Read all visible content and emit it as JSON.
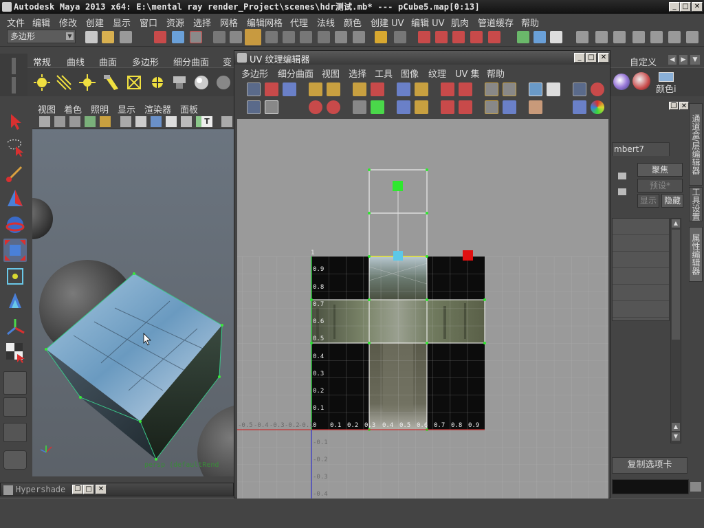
{
  "window": {
    "title": "Autodesk Maya 2013 x64: E:\\mental ray render_Project\\scenes\\hdr测试.mb*   ---   pCube5.map[0:13]",
    "min_label": "_",
    "max_label": "□",
    "close_label": "✕"
  },
  "main_menu": [
    "文件",
    "编辑",
    "修改",
    "创建",
    "显示",
    "窗口",
    "资源",
    "选择",
    "网格",
    "编辑网格",
    "代理",
    "法线",
    "颜色",
    "创建 UV",
    "编辑 UV",
    "肌肉",
    "管道缓存",
    "帮助"
  ],
  "status_line": {
    "mode": "多边形"
  },
  "shelf": {
    "tabs": [
      "常规",
      "曲线",
      "曲面",
      "多边形",
      "细分曲面",
      "变"
    ],
    "right_tabs": [
      "自定义"
    ],
    "right_label": "颜色i"
  },
  "viewport": {
    "menu": [
      "视图",
      "着色",
      "照明",
      "显示",
      "渲染器",
      "面板"
    ],
    "camera_label": "persp (defaultRend"
  },
  "hypershade": {
    "title": "Hypershade"
  },
  "uv_editor": {
    "title": "UV 纹理编辑器",
    "menu": [
      "多边形",
      "细分曲面",
      "视图",
      "选择",
      "工具",
      "图像",
      "纹理",
      "UV 集",
      "帮助"
    ],
    "v_ticks": [
      "1",
      "0.9",
      "0.8",
      "0.7",
      "0.6",
      "0.5",
      "0.4",
      "0.3",
      "0.2",
      "0.1"
    ],
    "u_ticks": [
      "0",
      "0.1",
      "0.2",
      "0.3",
      "0.4",
      "0.5",
      "0.6",
      "0.7",
      "0.8",
      "0.9"
    ],
    "neg_v_ticks": [
      "-0.1",
      "-0.2",
      "-0.3",
      "-0.4"
    ],
    "neg_u_ticks": [
      "-0.5",
      "-0.4",
      "-0.3",
      "-0.2",
      "-0.1"
    ]
  },
  "right_panel": {
    "material_label": "mbert7",
    "buttons": {
      "focus": "聚焦",
      "preset": "预设*",
      "show": "显示",
      "hide": "隐藏"
    },
    "vertical_tabs": [
      "通道盒/层编辑器",
      "工具设置",
      "属性编辑器"
    ],
    "copy_tab": "复制选项卡"
  },
  "colors": {
    "uv_green_handle": "#2ee82e",
    "uv_cyan_handle": "#5cc8e8",
    "uv_red_handle": "#e01010",
    "u_axis": "#c83030",
    "v_axis": "#3030c8"
  }
}
